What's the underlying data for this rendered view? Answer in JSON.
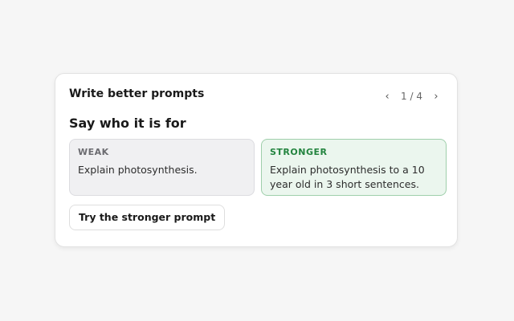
{
  "card": {
    "title": "Write better prompts",
    "pager": {
      "prev_icon": "chevron-left-icon",
      "next_icon": "chevron-right-icon",
      "prev_glyph": "‹",
      "next_glyph": "›",
      "current": 1,
      "total": 4,
      "text": "1 / 4"
    },
    "section_title": "Say who it is for",
    "weak": {
      "label": "WEAK",
      "text": "Explain photosynthesis."
    },
    "stronger": {
      "label": "STRONGER",
      "text": "Explain photosynthesis to a 10 year old in 3 short sentences."
    },
    "try_button_label": "Try the stronger prompt"
  },
  "colors": {
    "stronger_accent": "#23843f",
    "stronger_bg": "#ebf6ee",
    "weak_bg": "#f0f0f2"
  }
}
